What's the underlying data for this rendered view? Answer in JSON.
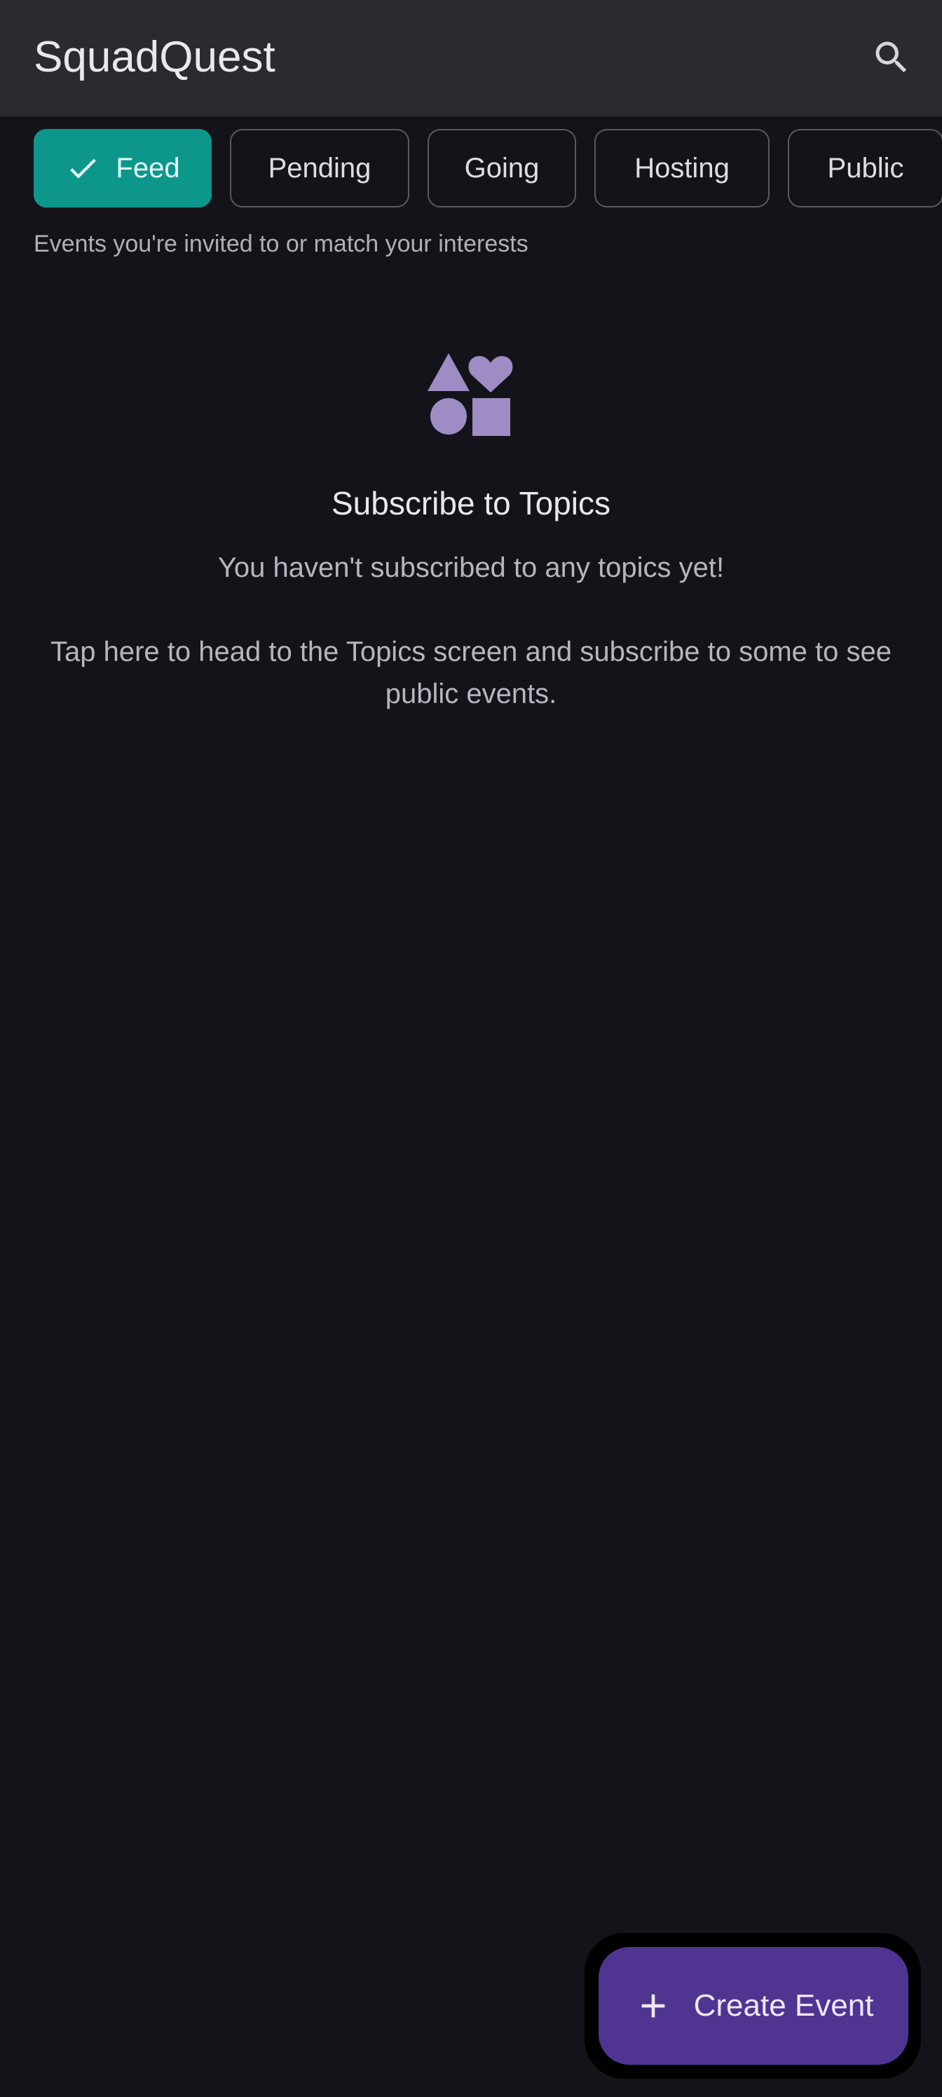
{
  "app_bar": {
    "title": "SquadQuest",
    "search_icon": "search-icon"
  },
  "filters": {
    "chips": [
      {
        "label": "Feed",
        "selected": true
      },
      {
        "label": "Pending",
        "selected": false
      },
      {
        "label": "Going",
        "selected": false
      },
      {
        "label": "Hosting",
        "selected": false
      },
      {
        "label": "Public",
        "selected": false
      }
    ],
    "description": "Events you're invited to or match your interests"
  },
  "empty_state": {
    "icon": "shapes-icon",
    "title": "Subscribe to Topics",
    "message": "You haven't subscribed to any topics yet!",
    "action_text": "Tap here to head to the Topics screen and subscribe to some to see public events."
  },
  "fab": {
    "label": "Create Event",
    "icon": "plus-icon"
  },
  "colors": {
    "background": "#15131a",
    "app_bar": "#2b2a2f",
    "selected_chip": "#0d978b",
    "fab": "#4f3591",
    "icon_accent": "#9d8dc4"
  }
}
